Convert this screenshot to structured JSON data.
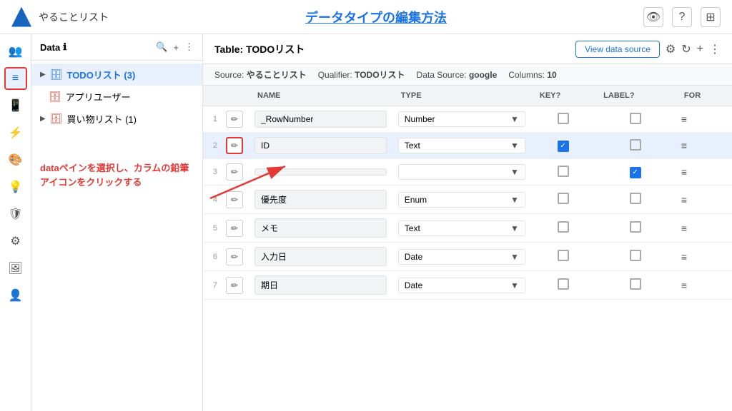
{
  "header": {
    "app_name": "やることリスト",
    "page_title": "データタイプの編集方法",
    "icons": [
      "👁",
      "?",
      "⊞"
    ]
  },
  "sidebar": {
    "icons": [
      {
        "name": "people-icon",
        "symbol": "👥",
        "active": false
      },
      {
        "name": "table-icon",
        "symbol": "≡",
        "active": true,
        "bordered": true
      },
      {
        "name": "mobile-icon",
        "symbol": "📱",
        "active": false
      },
      {
        "name": "lightning-icon",
        "symbol": "⚡",
        "active": false
      },
      {
        "name": "palette-icon",
        "symbol": "🎨",
        "active": false
      },
      {
        "name": "bulb-icon",
        "symbol": "💡",
        "active": false
      },
      {
        "name": "shield-icon",
        "symbol": "🛡",
        "active": false
      },
      {
        "name": "gear-icon",
        "symbol": "⚙",
        "active": false
      },
      {
        "name": "image-icon",
        "symbol": "🖼",
        "active": false
      },
      {
        "name": "user-icon",
        "symbol": "👤",
        "active": false
      }
    ]
  },
  "data_pane": {
    "title": "Data",
    "info_icon": "ℹ",
    "items": [
      {
        "label": "TODOリスト (3)",
        "selected": true,
        "indent": 0,
        "expanded": true
      },
      {
        "label": "アプリユーザー",
        "selected": false,
        "indent": 0,
        "expanded": false
      },
      {
        "label": "買い物リスト (1)",
        "selected": false,
        "indent": 0,
        "expanded": false
      }
    ]
  },
  "table": {
    "title": "Table: TODOリスト",
    "view_data_btn": "View data source",
    "source_label": "Source:",
    "source_value": "やることリスト",
    "qualifier_label": "Qualifier:",
    "qualifier_value": "TODOリスト",
    "data_source_label": "Data Source:",
    "data_source_value": "google",
    "columns_label": "Columns:",
    "columns_value": "10",
    "columns": [
      "NAME",
      "TYPE",
      "KEY?",
      "LABEL?",
      "FOR"
    ],
    "rows": [
      {
        "num": "1",
        "field": "_RowNumber",
        "type": "Number",
        "key": false,
        "label": false,
        "highlighted": false,
        "edit_highlighted": false
      },
      {
        "num": "2",
        "field": "ID",
        "type": "Text",
        "key": true,
        "label": false,
        "highlighted": true,
        "edit_highlighted": true
      },
      {
        "num": "3",
        "field": "",
        "type": "",
        "key": false,
        "label": true,
        "highlighted": false,
        "edit_highlighted": false
      },
      {
        "num": "4",
        "field": "優先度",
        "type": "Enum",
        "key": false,
        "label": false,
        "highlighted": false,
        "edit_highlighted": false
      },
      {
        "num": "5",
        "field": "メモ",
        "type": "Text",
        "key": false,
        "label": false,
        "highlighted": false,
        "edit_highlighted": false
      },
      {
        "num": "6",
        "field": "入力日",
        "type": "Date",
        "key": false,
        "label": false,
        "highlighted": false,
        "edit_highlighted": false
      },
      {
        "num": "7",
        "field": "期日",
        "type": "Date",
        "key": false,
        "label": false,
        "highlighted": false,
        "edit_highlighted": false
      }
    ]
  },
  "annotation": {
    "text": "dataペインを選択し、カラムの鉛筆アイコンをクリックする"
  }
}
